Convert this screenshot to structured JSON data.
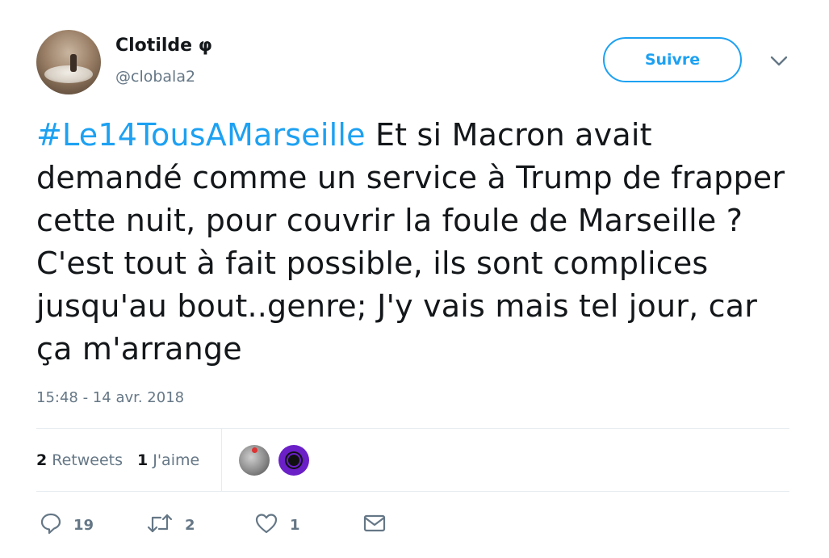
{
  "user": {
    "name": "Clotilde φ",
    "handle": "@clobala2"
  },
  "header": {
    "follow_label": "Suivre"
  },
  "tweet": {
    "hashtag": "#Le14TousAMarseille",
    "body": " Et si Macron avait demandé comme un service à Trump de frapper cette nuit, pour couvrir la foule de Marseille ? C'est tout à fait possible, ils sont complices jusqu'au bout..genre; J'y vais mais tel jour, car ça m'arrange",
    "timestamp": "15:48 - 14 avr. 2018"
  },
  "stats": {
    "retweets_count": "2",
    "retweets_label": "Retweets",
    "likes_count": "1",
    "likes_label": "J'aime"
  },
  "actions": {
    "reply_count": "19",
    "retweet_count": "2",
    "like_count": "1"
  },
  "colors": {
    "accent": "#1da1f2",
    "secondary_text": "#657786",
    "divider": "#e6ecf0"
  },
  "icons": [
    "chevron-down-icon",
    "reply-icon",
    "retweet-icon",
    "heart-icon",
    "envelope-icon"
  ]
}
